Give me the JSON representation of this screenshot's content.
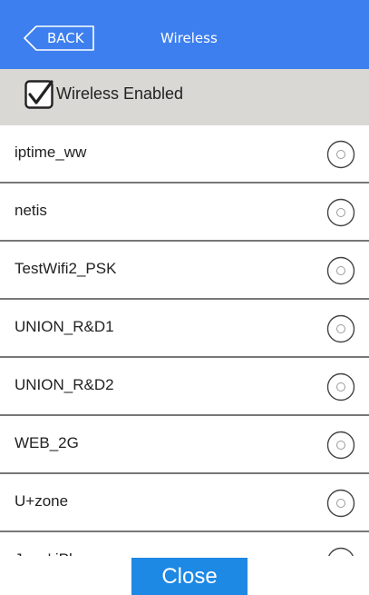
{
  "header": {
    "back_label": "BACK",
    "title": "Wireless"
  },
  "wireless_toggle": {
    "label": "Wireless Enabled",
    "checked": true
  },
  "networks": [
    {
      "ssid": "iptime_ww",
      "selected": false
    },
    {
      "ssid": "netis",
      "selected": false
    },
    {
      "ssid": "TestWifi2_PSK",
      "selected": false
    },
    {
      "ssid": "UNION_R&D1",
      "selected": false
    },
    {
      "ssid": "UNION_R&D2",
      "selected": false
    },
    {
      "ssid": "WEB_2G",
      "selected": false
    },
    {
      "ssid": "U+zone",
      "selected": false
    },
    {
      "ssid": "June' iPhone",
      "selected": false
    }
  ],
  "footer": {
    "close_label": "Close"
  },
  "colors": {
    "header_bg": "#3d7fef",
    "toggle_row_bg": "#d9d8d4",
    "close_button_bg": "#1e88e5"
  },
  "icons": {
    "back": "back-arrow-icon",
    "checkbox": "checkmark-icon",
    "radio": "radio-unselected-icon"
  }
}
